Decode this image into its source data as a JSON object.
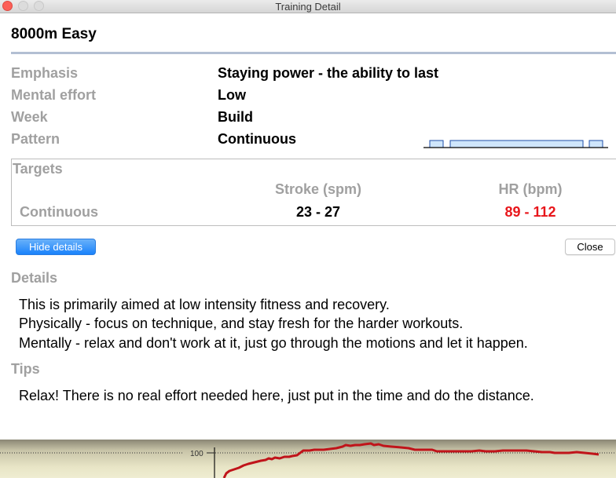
{
  "window": {
    "title": "Training Detail"
  },
  "workout": {
    "title": "8000m Easy"
  },
  "info": [
    {
      "label": "Emphasis",
      "value": "Staying power - the ability to last"
    },
    {
      "label": "Mental effort",
      "value": "Low"
    },
    {
      "label": "Week",
      "value": "Build"
    },
    {
      "label": "Pattern",
      "value": "Continuous"
    }
  ],
  "pattern_graph": {
    "segments": [
      "warm-up",
      "main",
      "cool-down"
    ],
    "fill_color": "#cfe6fb",
    "stroke_color": "#1f4fa8"
  },
  "targets": {
    "title": "Targets",
    "columns": [
      "Stroke (spm)",
      "HR (bpm)"
    ],
    "rows": [
      {
        "label": "Continuous",
        "stroke": "23 - 27",
        "hr": "89 - 112"
      }
    ],
    "hr_color": "#e8161b"
  },
  "buttons": {
    "hide_details": "Hide details",
    "close": "Close"
  },
  "details": {
    "heading": "Details",
    "lines": [
      "This is primarily aimed at low intensity fitness and recovery.",
      "Physically - focus on technique, and stay fresh for the harder workouts.",
      "Mentally - relax and don't work at it, just go through the motions and let it happen."
    ]
  },
  "tips": {
    "heading": "Tips",
    "lines": [
      "Relax!  There is no real effort needed here, just put in the time and do the distance."
    ]
  },
  "background_chart": {
    "y_tick_label": "100",
    "line_color": "#c0141a"
  }
}
